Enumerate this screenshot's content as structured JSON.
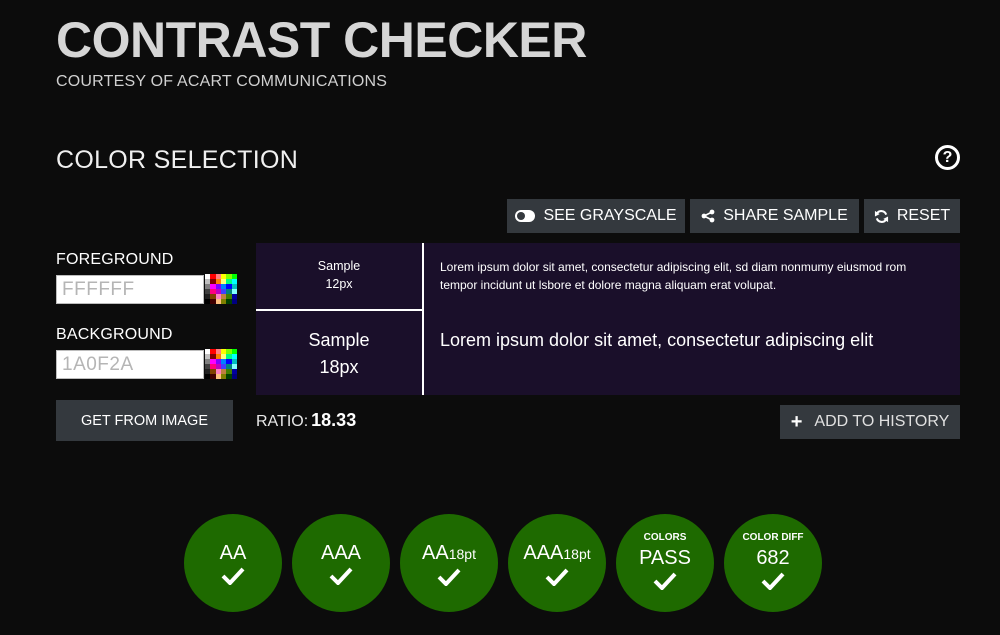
{
  "header": {
    "title": "CONTRAST CHECKER",
    "subtitle": "COURTESY OF ACART COMMUNICATIONS"
  },
  "section": {
    "title": "COLOR SELECTION",
    "help_icon": "question-circle-icon"
  },
  "toolbar": {
    "grayscale_label": "SEE GRAYSCALE",
    "grayscale_icon": "toggle-icon",
    "share_label": "SHARE SAMPLE",
    "share_icon": "share-icon",
    "reset_label": "RESET",
    "reset_icon": "refresh-icon"
  },
  "inputs": {
    "foreground_label": "FOREGROUND",
    "foreground_value": "FFFFFF",
    "background_label": "BACKGROUND",
    "background_value": "1A0F2A",
    "get_from_image_label": "GET FROM IMAGE"
  },
  "preview": {
    "background_color": "#1a0f2a",
    "foreground_color": "#ffffff",
    "sample_small_line1": "Sample",
    "sample_small_line2": "12px",
    "sample_large_line1": "Sample",
    "sample_large_line2": "18px",
    "lorem_small": "Lorem ipsum dolor sit amet, consectetur adipiscing elit, sd diam nonmumy eiusmod rom tempor incidunt ut lsbore et dolore magna aliquam erat volupat.",
    "lorem_large": "Lorem ipsum dolor sit amet, consectetur adipiscing elit"
  },
  "ratio": {
    "label": "RATIO:",
    "value": "18.33"
  },
  "history": {
    "add_label": "ADD TO HISTORY",
    "icon": "plus-icon"
  },
  "results": {
    "pass_color": "#1e6a00",
    "badges": [
      {
        "caption": "",
        "main": "AA",
        "suffix": "",
        "status": "pass"
      },
      {
        "caption": "",
        "main": "AAA",
        "suffix": "",
        "status": "pass"
      },
      {
        "caption": "",
        "main": "AA",
        "suffix": "18pt",
        "status": "pass"
      },
      {
        "caption": "",
        "main": "AAA",
        "suffix": "18pt",
        "status": "pass"
      },
      {
        "caption": "COLORS",
        "main": "PASS",
        "suffix": "",
        "status": "pass"
      },
      {
        "caption": "COLOR DIFF",
        "main": "682",
        "suffix": "",
        "status": "pass"
      }
    ]
  },
  "palette_colors": [
    "#ffffff",
    "#ff0000",
    "#ff8080",
    "#ffff00",
    "#80ff00",
    "#00ff00",
    "#c0c0c0",
    "#800000",
    "#ff8000",
    "#ffff80",
    "#00ff80",
    "#00ffff",
    "#808080",
    "#ff00ff",
    "#8000ff",
    "#0080ff",
    "#0000ff",
    "#00c0c0",
    "#404040",
    "#ff0080",
    "#c000c0",
    "#4040ff",
    "#008080",
    "#80ffff",
    "#202020",
    "#804000",
    "#ff80c0",
    "#c08040",
    "#408000",
    "#0000a0",
    "#000000",
    "#400000",
    "#ffc080",
    "#808000",
    "#004000",
    "#000080"
  ]
}
